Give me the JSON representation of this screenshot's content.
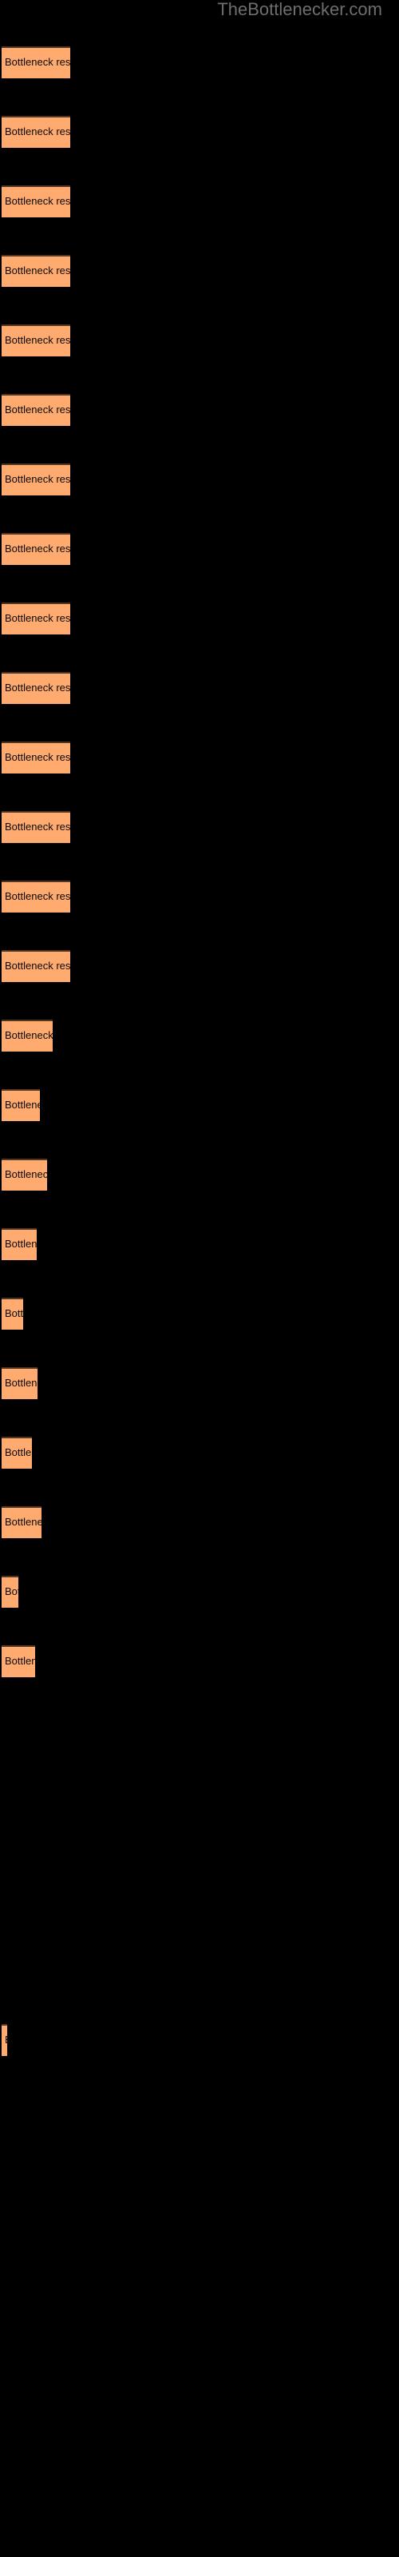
{
  "header": {
    "site_title": "TheBottlenecker.com",
    "title_color": "#6e6e6e"
  },
  "colors": {
    "background": "#000000",
    "bar_fill": "#ffab70",
    "bar_top_border": "#52341f",
    "bar_label_text": "#0a0a0a"
  },
  "chart_data": {
    "type": "bar",
    "orientation": "horizontal",
    "title": "",
    "subtitle": "",
    "xlabel": "",
    "ylabel": "",
    "grid": false,
    "legend": null,
    "axis_visible": false,
    "categories": [
      "",
      "",
      "",
      "",
      "",
      "",
      "",
      "",
      "",
      "",
      "",
      "",
      "",
      "",
      "",
      "",
      "",
      "",
      "",
      "",
      "",
      "",
      "",
      ""
    ],
    "bar_label_text": "Bottleneck result",
    "values": [
      86,
      86,
      86,
      86,
      86,
      86,
      86,
      86,
      86,
      86,
      86,
      86,
      86,
      86,
      64,
      50,
      56,
      44,
      36,
      46,
      40,
      48,
      32,
      44,
      7
    ],
    "xlim": [
      0,
      500
    ],
    "bars": [
      {
        "label": "Bottleneck result",
        "width": 86,
        "top": 58
      },
      {
        "label": "Bottleneck result",
        "width": 86,
        "top": 145
      },
      {
        "label": "Bottleneck result",
        "width": 86,
        "top": 232
      },
      {
        "label": "Bottleneck result",
        "width": 86,
        "top": 319
      },
      {
        "label": "Bottleneck result",
        "width": 86,
        "top": 406
      },
      {
        "label": "Bottleneck result",
        "width": 86,
        "top": 493
      },
      {
        "label": "Bottleneck result",
        "width": 86,
        "top": 580
      },
      {
        "label": "Bottleneck result",
        "width": 86,
        "top": 667
      },
      {
        "label": "Bottleneck result",
        "width": 86,
        "top": 754
      },
      {
        "label": "Bottleneck result",
        "width": 86,
        "top": 841
      },
      {
        "label": "Bottleneck result",
        "width": 86,
        "top": 928
      },
      {
        "label": "Bottleneck result",
        "width": 86,
        "top": 1015
      },
      {
        "label": "Bottleneck result",
        "width": 86,
        "top": 1102
      },
      {
        "label": "Bottleneck result",
        "width": 86,
        "top": 1189
      },
      {
        "label": "Bottleneck result",
        "width": 64,
        "top": 1276
      },
      {
        "label": "Bottleneck result",
        "width": 48,
        "top": 1363
      },
      {
        "label": "Bottleneck result",
        "width": 57,
        "top": 1450
      },
      {
        "label": "Bottleneck result",
        "width": 44,
        "top": 1537
      },
      {
        "label": "Bottleneck result",
        "width": 27,
        "top": 1624
      },
      {
        "label": "Bottleneck result",
        "width": 45,
        "top": 1711
      },
      {
        "label": "Bottleneck result",
        "width": 38,
        "top": 1798
      },
      {
        "label": "Bottleneck result",
        "width": 50,
        "top": 1885
      },
      {
        "label": "Bottleneck result",
        "width": 21,
        "top": 1972
      },
      {
        "label": "Bottleneck result",
        "width": 42,
        "top": 2059
      },
      {
        "label": "Bottleneck result",
        "width": 7,
        "top": 2533
      }
    ]
  }
}
